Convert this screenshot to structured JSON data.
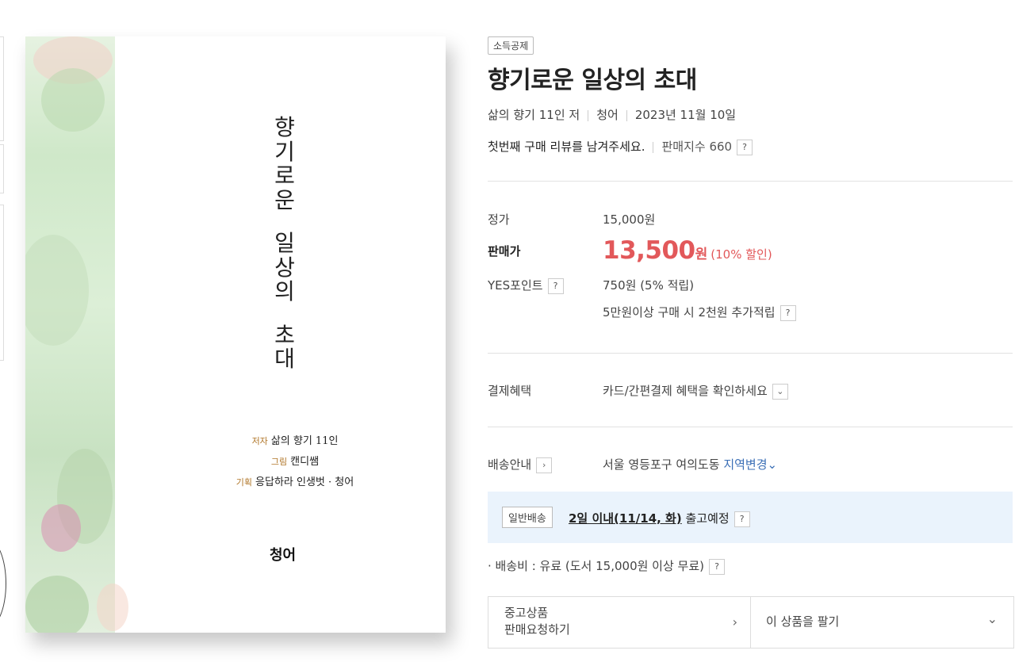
{
  "book": {
    "badge": "소득공제",
    "title": "향기로운 일상의 초대",
    "author": "삶의 향기 11인 저",
    "publisher": "청어",
    "date": "2023년 11월 10일",
    "review_prompt": "첫번째 구매 리뷰를 남겨주세요.",
    "sales_index": "판매지수 660"
  },
  "cover": {
    "title_chars": [
      "향",
      "기",
      "로",
      "운",
      "",
      "일",
      "상",
      "의",
      "",
      "초",
      "대"
    ],
    "credits": [
      {
        "role": "저자",
        "name": "삶의 향기 11인"
      },
      {
        "role": "그림",
        "name": "캔디쌤"
      },
      {
        "role": "기획",
        "name": "응답하라 인생벗 · 청어"
      }
    ],
    "logo": "청어"
  },
  "price": {
    "list_label": "정가",
    "list_value": "15,000원",
    "sale_label": "판매가",
    "sale_value": "13,500",
    "sale_unit": "원",
    "discount": "(10% 할인)",
    "points_label": "YES포인트",
    "points_value": "750원 (5% 적립)",
    "extra_points": "5만원이상 구매 시 2천원 추가적립"
  },
  "payment": {
    "label": "결제혜택",
    "value": "카드/간편결제 혜택을 확인하세요"
  },
  "shipping": {
    "label": "배송안내",
    "location": "서울 영등포구 여의도동",
    "change_link": "지역변경",
    "chip": "일반배송",
    "eta": "2일 이내(11/14, 화)",
    "eta_suffix": "출고예정",
    "fee": "배송비 : 유료 (도서 15,000원 이상 무료)"
  },
  "used": {
    "left_line1": "중고상품",
    "left_line2": "판매요청하기",
    "right": "이 상품을 팔기"
  },
  "icons": {
    "question": "?",
    "chevron_down": "⌄",
    "chevron_right": "›"
  }
}
